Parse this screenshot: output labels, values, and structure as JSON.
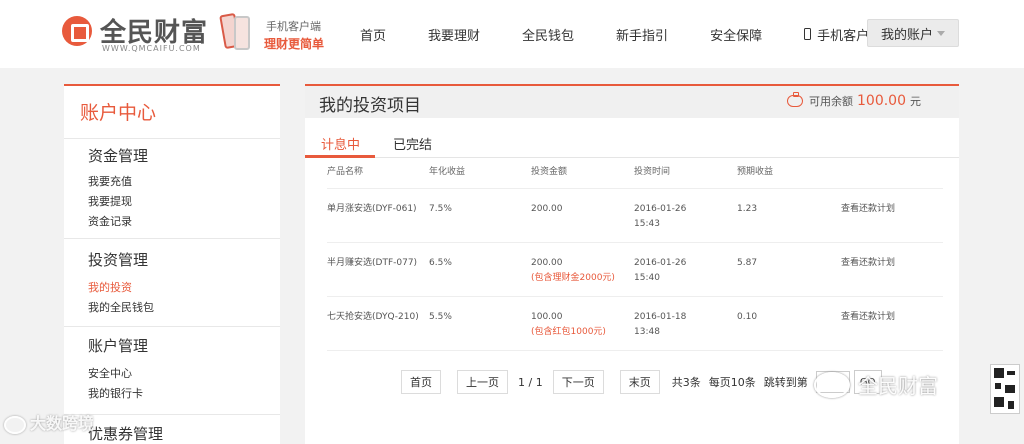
{
  "brand": {
    "name": "全民财富",
    "domain": "WWW.QMCAIFU.COM",
    "app_promo_line1": "手机客户端",
    "app_promo_line2": "理财更简单"
  },
  "nav": {
    "items": [
      "首页",
      "我要理财",
      "全民钱包",
      "新手指引",
      "安全保障",
      "手机客户端"
    ],
    "account_label": "我的账户"
  },
  "sidebar": {
    "title": "账户中心",
    "groups": [
      {
        "heading": "资金管理",
        "links": [
          "我要充值",
          "我要提现",
          "资金记录"
        ]
      },
      {
        "heading": "投资管理",
        "links": [
          "我的投资",
          "我的全民钱包"
        ],
        "active_index": 0
      },
      {
        "heading": "账户管理",
        "links": [
          "安全中心",
          "我的银行卡"
        ]
      },
      {
        "heading": "优惠券管理",
        "links": []
      }
    ]
  },
  "main": {
    "title": "我的投资项目",
    "balance_label": "可用余额",
    "balance_amount": "100.00",
    "balance_unit": "元",
    "tabs": [
      "计息中",
      "已完结"
    ],
    "active_tab": 0,
    "columns": [
      "产品名称",
      "年化收益",
      "投资金额",
      "投资时间",
      "预期收益"
    ],
    "rows": [
      {
        "name": "单月涨安选(DYF-061)",
        "rate": "7.5%",
        "amount": "200.00",
        "note": "",
        "date": "2016-01-26",
        "time": "15:43",
        "expected": "1.23",
        "action": "查看还款计划"
      },
      {
        "name": "半月赚安选(DTF-077)",
        "rate": "6.5%",
        "amount": "200.00",
        "note": "(包含理财金2000元)",
        "date": "2016-01-26",
        "time": "15:40",
        "expected": "5.87",
        "action": "查看还款计划"
      },
      {
        "name": "七天抢安选(DYQ-210)",
        "rate": "5.5%",
        "amount": "100.00",
        "note": "(包含红包1000元)",
        "date": "2016-01-18",
        "time": "13:48",
        "expected": "0.10",
        "action": "查看还款计划"
      }
    ]
  },
  "pager": {
    "first": "首页",
    "prev": "上一页",
    "status": "1 / 1",
    "next": "下一页",
    "last": "末页",
    "total": "共3条",
    "per_page": "每页10条",
    "jump_label": "跳转到第",
    "go": "GO"
  },
  "watermarks": {
    "left": "大数跨境",
    "right": "全民财富"
  },
  "colors": {
    "accent": "#e85a3c",
    "page_bg": "#f2f2f2"
  }
}
